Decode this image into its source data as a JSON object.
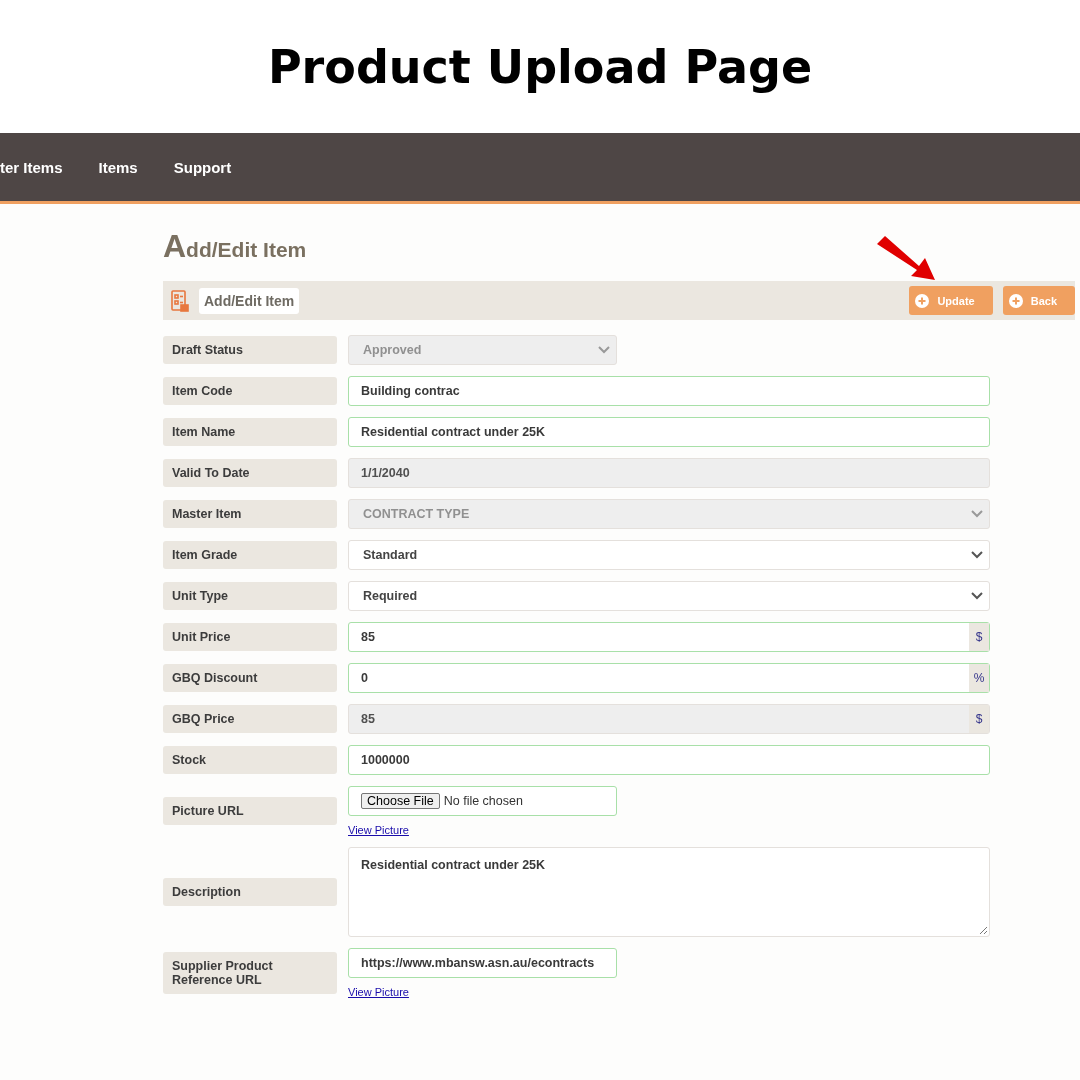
{
  "banner_title": "Product Upload Page",
  "nav": [
    {
      "label": "ter Items"
    },
    {
      "label": "Items"
    },
    {
      "label": "Support"
    }
  ],
  "page_heading": "Add/Edit Item",
  "panel": {
    "title": "Add/Edit Item",
    "buttons": [
      {
        "label": "Update",
        "annotated": true
      },
      {
        "label": "Back",
        "annotated": false
      }
    ]
  },
  "fields": [
    {
      "label": "Draft Status",
      "kind": "select",
      "value": "Approved",
      "disabled": true,
      "valid": false,
      "short": true
    },
    {
      "label": "Item Code",
      "kind": "text",
      "value": "Building contrac",
      "disabled": false,
      "valid": true,
      "short": false
    },
    {
      "label": "Item Name",
      "kind": "text",
      "value": "Residential contract under 25K",
      "disabled": false,
      "valid": true,
      "short": false
    },
    {
      "label": "Valid To Date",
      "kind": "text",
      "value": "1/1/2040",
      "disabled": true,
      "valid": false,
      "short": false
    },
    {
      "label": "Master Item",
      "kind": "select",
      "value": "CONTRACT TYPE",
      "disabled": true,
      "valid": false,
      "short": false
    },
    {
      "label": "Item Grade",
      "kind": "select",
      "value": "Standard",
      "disabled": false,
      "valid": false,
      "short": false
    },
    {
      "label": "Unit Type",
      "kind": "select",
      "value": "Required",
      "disabled": false,
      "valid": false,
      "short": false
    },
    {
      "label": "Unit Price",
      "kind": "text",
      "value": "85",
      "addon": "$",
      "disabled": false,
      "valid": true,
      "short": false
    },
    {
      "label": "GBQ Discount",
      "kind": "text",
      "value": "0",
      "addon": "%",
      "disabled": false,
      "valid": true,
      "short": false
    },
    {
      "label": "GBQ Price",
      "kind": "text",
      "value": "85",
      "addon": "$",
      "disabled": true,
      "valid": false,
      "short": false
    },
    {
      "label": "Stock",
      "kind": "text",
      "value": "1000000",
      "disabled": false,
      "valid": true,
      "short": false
    },
    {
      "label": "Picture URL",
      "kind": "file",
      "button": "Choose File",
      "value": "No file chosen",
      "link": "View Picture",
      "disabled": false,
      "valid": true,
      "short": true
    },
    {
      "label": "Description",
      "kind": "textarea",
      "value": "Residential contract under 25K",
      "disabled": false,
      "valid": false,
      "short": false
    },
    {
      "label": "Supplier Product Reference URL",
      "kind": "text",
      "value": "https://www.mbansw.asn.au/econtracts",
      "link": "View Picture",
      "disabled": false,
      "valid": true,
      "short": true
    }
  ]
}
